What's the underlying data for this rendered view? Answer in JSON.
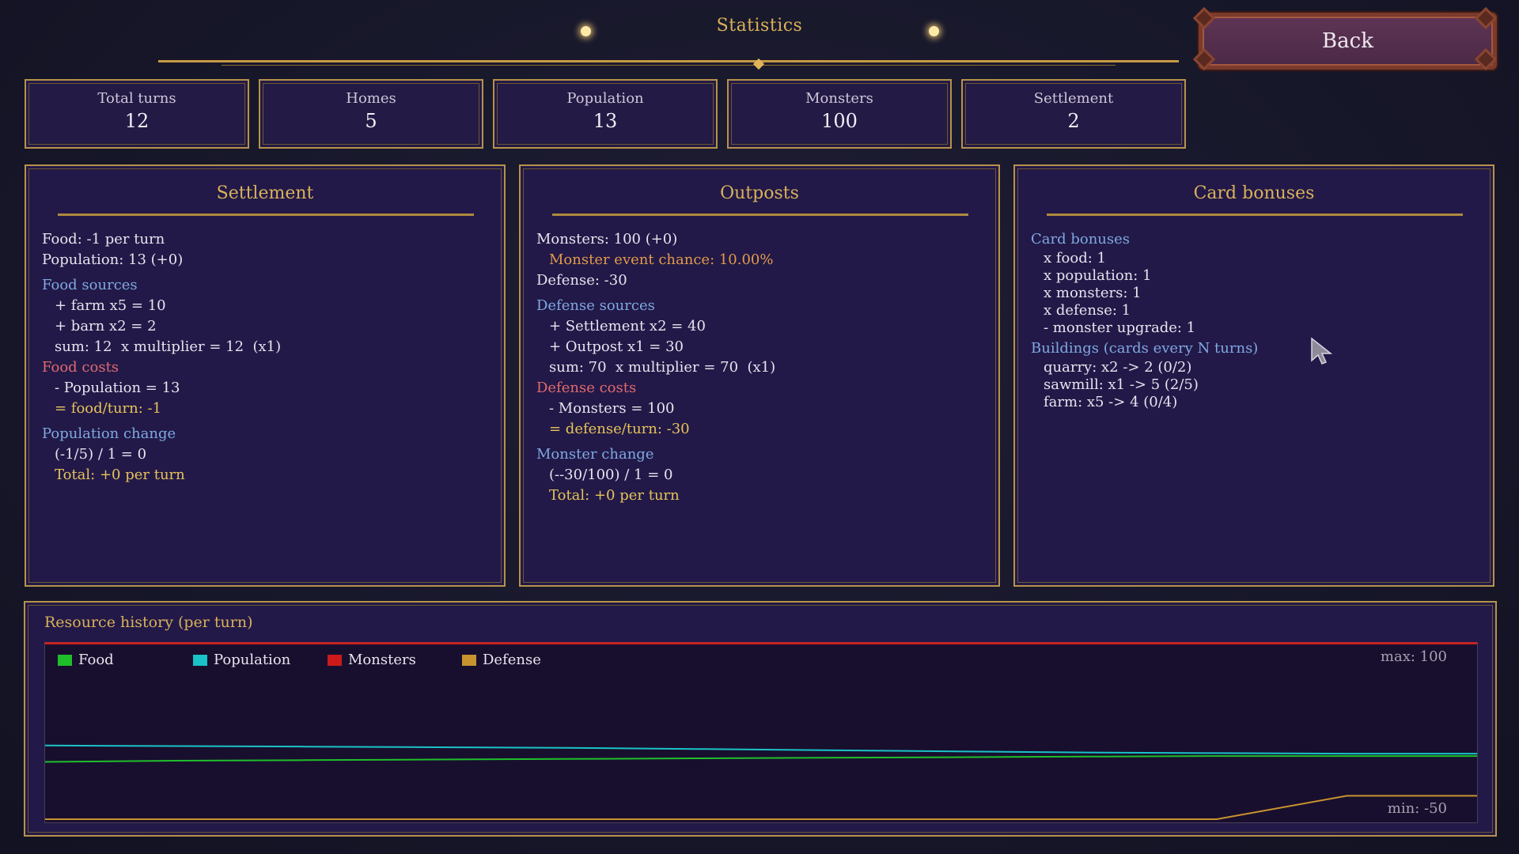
{
  "header": {
    "title": "Statistics",
    "back_label": "Back"
  },
  "stats": [
    {
      "label": "Total turns",
      "value": "12"
    },
    {
      "label": "Homes",
      "value": "5"
    },
    {
      "label": "Population",
      "value": "13"
    },
    {
      "label": "Monsters",
      "value": "100"
    },
    {
      "label": "Settlement",
      "value": "2"
    }
  ],
  "settlement": {
    "title": "Settlement",
    "food": "Food: -1 per turn",
    "population": "Population: 13 (+0)",
    "food_sources_heading": "Food sources",
    "food_sources": [
      "+ farm x5 = 10",
      "+ barn x2 = 2",
      "sum: 12  x multiplier = 12  (x1)"
    ],
    "food_costs_heading": "Food costs",
    "food_costs": [
      "- Population = 13"
    ],
    "food_turn": "= food/turn: -1",
    "pop_change_heading": "Population change",
    "pop_change": "(-1/5) / 1 = 0",
    "pop_total": "Total: +0 per turn"
  },
  "outposts": {
    "title": "Outposts",
    "monsters": "Monsters: 100 (+0)",
    "event_chance": "Monster event chance: 10.00%",
    "defense": "Defense: -30",
    "defense_sources_heading": "Defense sources",
    "defense_sources": [
      "+ Settlement x2 = 40",
      "+ Outpost x1 = 30",
      "sum: 70  x multiplier = 70  (x1)"
    ],
    "defense_costs_heading": "Defense costs",
    "defense_costs": [
      "- Monsters = 100"
    ],
    "defense_turn": "= defense/turn: -30",
    "monster_change_heading": "Monster change",
    "monster_change": "(--30/100) / 1 = 0",
    "monster_total": "Total: +0 per turn"
  },
  "card_bonuses": {
    "title": "Card bonuses",
    "bonuses_heading": "Card bonuses",
    "bonuses": [
      "x food: 1",
      "x population: 1",
      "x monsters: 1",
      "x defense: 1",
      "- monster upgrade: 1"
    ],
    "buildings_heading": "Buildings (cards every N turns)",
    "buildings": [
      "quarry: x2 -> 2 (0/2)",
      "sawmill: x1 -> 5 (2/5)",
      "farm: x5 -> 4 (0/4)"
    ]
  },
  "history": {
    "title": "Resource history (per turn)",
    "max_label": "max: 100",
    "min_label": "min: -50"
  },
  "chart_data": {
    "type": "line",
    "ylim": [
      -50,
      100
    ],
    "x": [
      1,
      2,
      3,
      4,
      5,
      6,
      7,
      8,
      9,
      10,
      11,
      12
    ],
    "series": [
      {
        "name": "Food",
        "color": "#1fbf2a",
        "values": [
          -1,
          0,
          0.5,
          1,
          1.5,
          2,
          2.5,
          3,
          3.5,
          4,
          4,
          4
        ]
      },
      {
        "name": "Population",
        "color": "#19c3c8",
        "values": [
          13,
          12.5,
          12,
          11.5,
          11,
          10,
          9,
          8,
          7,
          6.5,
          6,
          6
        ]
      },
      {
        "name": "Monsters",
        "color": "#cc1a1a",
        "values": [
          100,
          100,
          100,
          100,
          100,
          100,
          100,
          100,
          100,
          100,
          100,
          100
        ]
      },
      {
        "name": "Defense",
        "color": "#c8922e",
        "values": [
          -50,
          -50,
          -50,
          -50,
          -50,
          -50,
          -50,
          -50,
          -50,
          -50,
          -30,
          -30
        ]
      }
    ]
  }
}
